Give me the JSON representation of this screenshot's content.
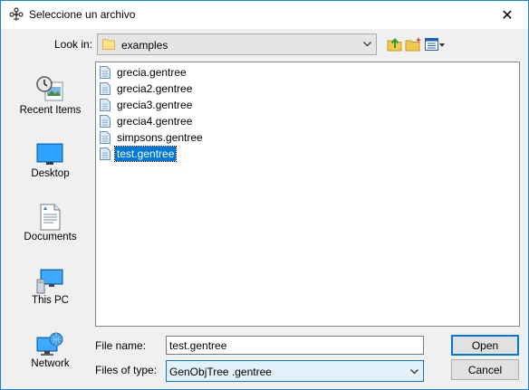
{
  "window": {
    "title": "Seleccione un archivo",
    "close_glyph": "✕"
  },
  "toolbar": {
    "look_in_label": "Look in:",
    "look_in_value": "examples",
    "icons": [
      "folder-icon",
      "up-folder-icon",
      "new-folder-icon",
      "view-menu-icon"
    ]
  },
  "places": [
    {
      "label": "Recent Items",
      "icon": "recent-items-icon"
    },
    {
      "label": "Desktop",
      "icon": "desktop-icon"
    },
    {
      "label": "Documents",
      "icon": "documents-icon"
    },
    {
      "label": "This PC",
      "icon": "this-pc-icon"
    },
    {
      "label": "Network",
      "icon": "network-icon"
    }
  ],
  "files": [
    {
      "name": "grecia.gentree",
      "selected": false
    },
    {
      "name": "grecia2.gentree",
      "selected": false
    },
    {
      "name": "grecia3.gentree",
      "selected": false
    },
    {
      "name": "grecia4.gentree",
      "selected": false
    },
    {
      "name": "simpsons.gentree",
      "selected": false
    },
    {
      "name": "test.gentree",
      "selected": true
    }
  ],
  "form": {
    "file_name_label": "File name:",
    "file_name_value": "test.gentree",
    "file_type_label": "Files of type:",
    "file_type_value": "GenObjTree .gentree"
  },
  "buttons": {
    "open": "Open",
    "cancel": "Cancel"
  },
  "colors": {
    "accent": "#0078d7",
    "selection": "#0078d7",
    "window_border": "#1883d7"
  }
}
